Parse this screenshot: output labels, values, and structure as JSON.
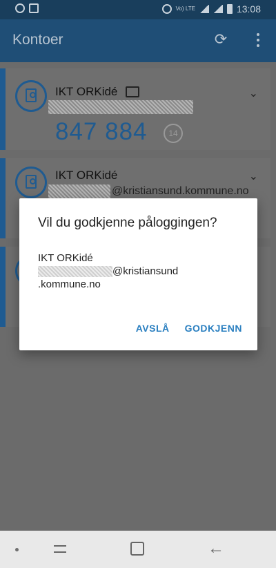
{
  "status_bar": {
    "time": "13:08",
    "network_label": "Vo) LTE",
    "icons": [
      "minus-circle-icon",
      "twitch-icon",
      "alarm-icon",
      "wifi-icon",
      "signal-icon",
      "battery-icon"
    ]
  },
  "app_bar": {
    "title": "Kontoer",
    "refresh_icon": "refresh-icon",
    "menu_icon": "more-vert-icon"
  },
  "accounts": [
    {
      "name": "IKT ORKidé",
      "code": "847 884",
      "timer": "14",
      "email_suffix": ""
    },
    {
      "name": "IKT ORKidé",
      "code": "",
      "timer": "",
      "email_suffix": "@kristiansund.kommune.no"
    }
  ],
  "dialog": {
    "title": "Vil du godkjenne påloggingen?",
    "account_name": "IKT ORKidé",
    "email_suffix": "@kristiansund",
    "email_line2": ".kommune.no",
    "deny_label": "AVSLÅ",
    "approve_label": "GODKJENN"
  },
  "colors": {
    "app_bar": "#1f4e76",
    "accent": "#1f5b91",
    "dialog_button": "#2a7fc0"
  }
}
